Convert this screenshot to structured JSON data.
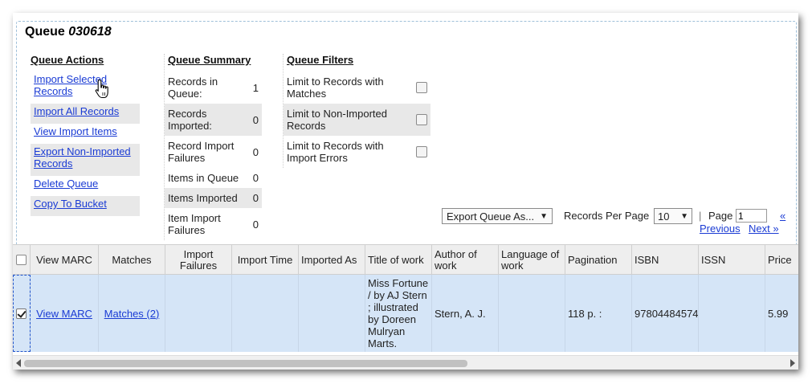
{
  "queue": {
    "title_prefix": "Queue",
    "name": "030618"
  },
  "actions": {
    "heading": "Queue Actions",
    "items": [
      "Import Selected Records",
      "Import All Records",
      "View Import Items",
      "Export Non-Imported Records",
      "Delete Queue",
      "Copy To Bucket"
    ]
  },
  "summary": {
    "heading": "Queue Summary",
    "rows": [
      {
        "label": "Records in Queue:",
        "value": "1"
      },
      {
        "label": "Records Imported:",
        "value": "0"
      },
      {
        "label": "Record Import Failures",
        "value": "0"
      },
      {
        "label": "Items in Queue",
        "value": "0"
      },
      {
        "label": "Items Imported",
        "value": "0"
      },
      {
        "label": "Item Import Failures",
        "value": "0"
      }
    ]
  },
  "filters": {
    "heading": "Queue Filters",
    "items": [
      {
        "label": "Limit to Records with Matches",
        "checked": false
      },
      {
        "label": "Limit to Non-Imported Records",
        "checked": false
      },
      {
        "label": "Limit to Records with Import Errors",
        "checked": false
      }
    ]
  },
  "paging": {
    "export_label": "Export Queue As...",
    "export_arrow": "▼",
    "records_per_page_label": "Records Per Page",
    "records_per_page_value": "10",
    "select_arrow": "▼",
    "page_label": "Page",
    "page_value": "1",
    "first_label": "«",
    "previous_label": "Previous",
    "next_label": "Next »"
  },
  "grid": {
    "columns": [
      "View MARC",
      "Matches",
      "Import Failures",
      "Import Time",
      "Imported As",
      "Title of work",
      "Author of work",
      "Language of work",
      "Pagination",
      "ISBN",
      "ISSN",
      "Price"
    ],
    "row": {
      "selected": true,
      "view_marc": "View MARC",
      "matches": "Matches (2)",
      "import_failures": "",
      "import_time": "",
      "imported_as": "",
      "title": "Miss Fortune / by AJ Stern ; illustrated by Doreen Mulryan Marts.",
      "author": "Stern, A. J.",
      "language": "",
      "pagination": "118 p. :",
      "isbn": "97804484574",
      "issn": "",
      "price": "5.99"
    }
  },
  "colors": {
    "link": "#1a3bd4",
    "selected_row": "#d5e5f7",
    "header_bg": "#eeeeee",
    "shaded_row": "#e8e8e8"
  }
}
